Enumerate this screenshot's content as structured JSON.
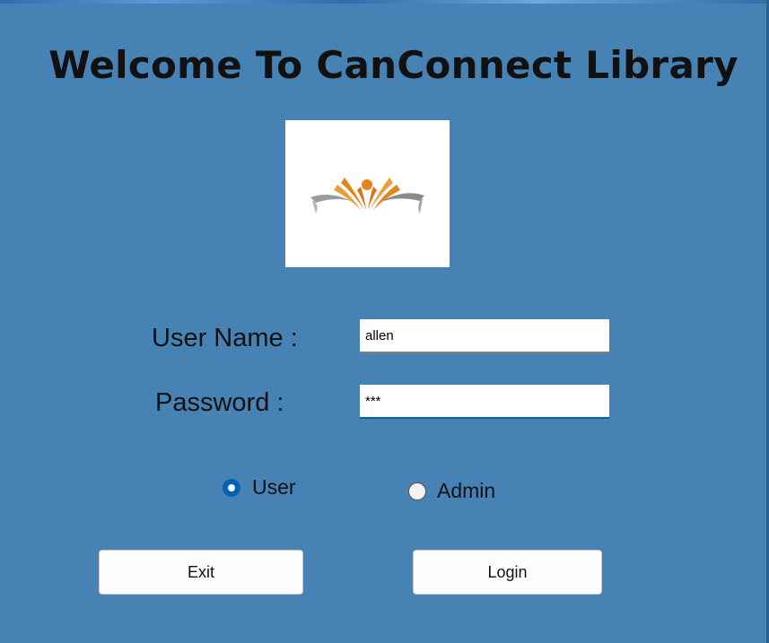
{
  "window": {
    "title": "Welcome To CanConnect Library"
  },
  "logo": {
    "icon": "open-book-reader-icon",
    "colors": {
      "orange": "#e8821a",
      "gray": "#8a8a8a"
    }
  },
  "form": {
    "username_label": "User Name :",
    "username_value": "allen",
    "password_label": "Password :",
    "password_value": "***"
  },
  "role": {
    "options": [
      {
        "label": "User",
        "selected": true
      },
      {
        "label": "Admin",
        "selected": false
      }
    ]
  },
  "buttons": {
    "exit_label": "Exit",
    "login_label": "Login"
  },
  "colors": {
    "background": "#4682b4",
    "accent": "#0063b1"
  }
}
